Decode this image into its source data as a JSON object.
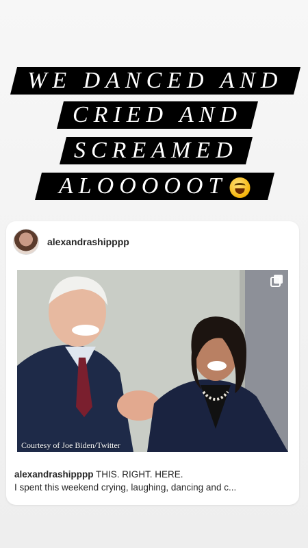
{
  "story": {
    "caption_lines": [
      "WE DANCED AND",
      "CRIED AND",
      "SCREAMED",
      "ALOOOOOT"
    ],
    "emoji": "rolling-on-floor-laughing"
  },
  "post": {
    "username": "alexandrashipppp",
    "image_credit": "Courtesy of Joe Biden/Twitter",
    "caption_user": "alexandrashipppp",
    "caption_text": "THIS. RIGHT. HERE.",
    "caption_line2": "I spent this weekend crying, laughing, dancing and c..."
  },
  "colors": {
    "background": "#f2f2f2",
    "caption_bg": "#000000",
    "caption_text": "#ffffff",
    "card_bg": "#ffffff",
    "text": "#262626"
  }
}
